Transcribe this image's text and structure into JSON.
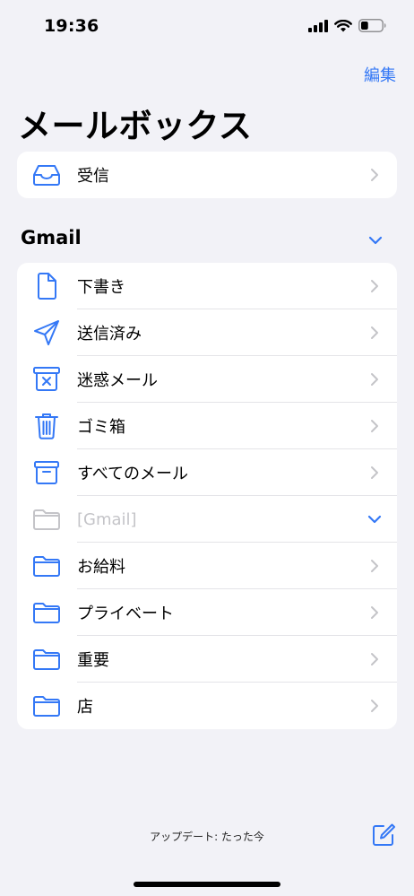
{
  "status_bar": {
    "time": "19:36",
    "battery_level": 0.35
  },
  "nav": {
    "edit_label": "編集"
  },
  "title": "メールボックス",
  "inbox": {
    "label": "受信",
    "icon": "inbox-tray-icon"
  },
  "gmail_section": {
    "title": "Gmail",
    "items": [
      {
        "label": "下書き",
        "icon": "document-icon"
      },
      {
        "label": "送信済み",
        "icon": "paper-plane-icon"
      },
      {
        "label": "迷惑メール",
        "icon": "junk-bin-icon"
      },
      {
        "label": "ゴミ箱",
        "icon": "trash-icon"
      },
      {
        "label": "すべてのメール",
        "icon": "archive-box-icon"
      },
      {
        "label": "[Gmail]",
        "icon": "folder-icon",
        "disabled": true
      },
      {
        "label": "お給料",
        "icon": "folder-icon"
      },
      {
        "label": "プライベート",
        "icon": "folder-icon"
      },
      {
        "label": "重要",
        "icon": "folder-icon"
      },
      {
        "label": "店",
        "icon": "folder-icon"
      }
    ]
  },
  "footer": {
    "update_status": "アップデート: たった今"
  },
  "colors": {
    "accent": "#3478f6",
    "background": "#f2f2f7",
    "disabled": "#c4c4c8"
  }
}
